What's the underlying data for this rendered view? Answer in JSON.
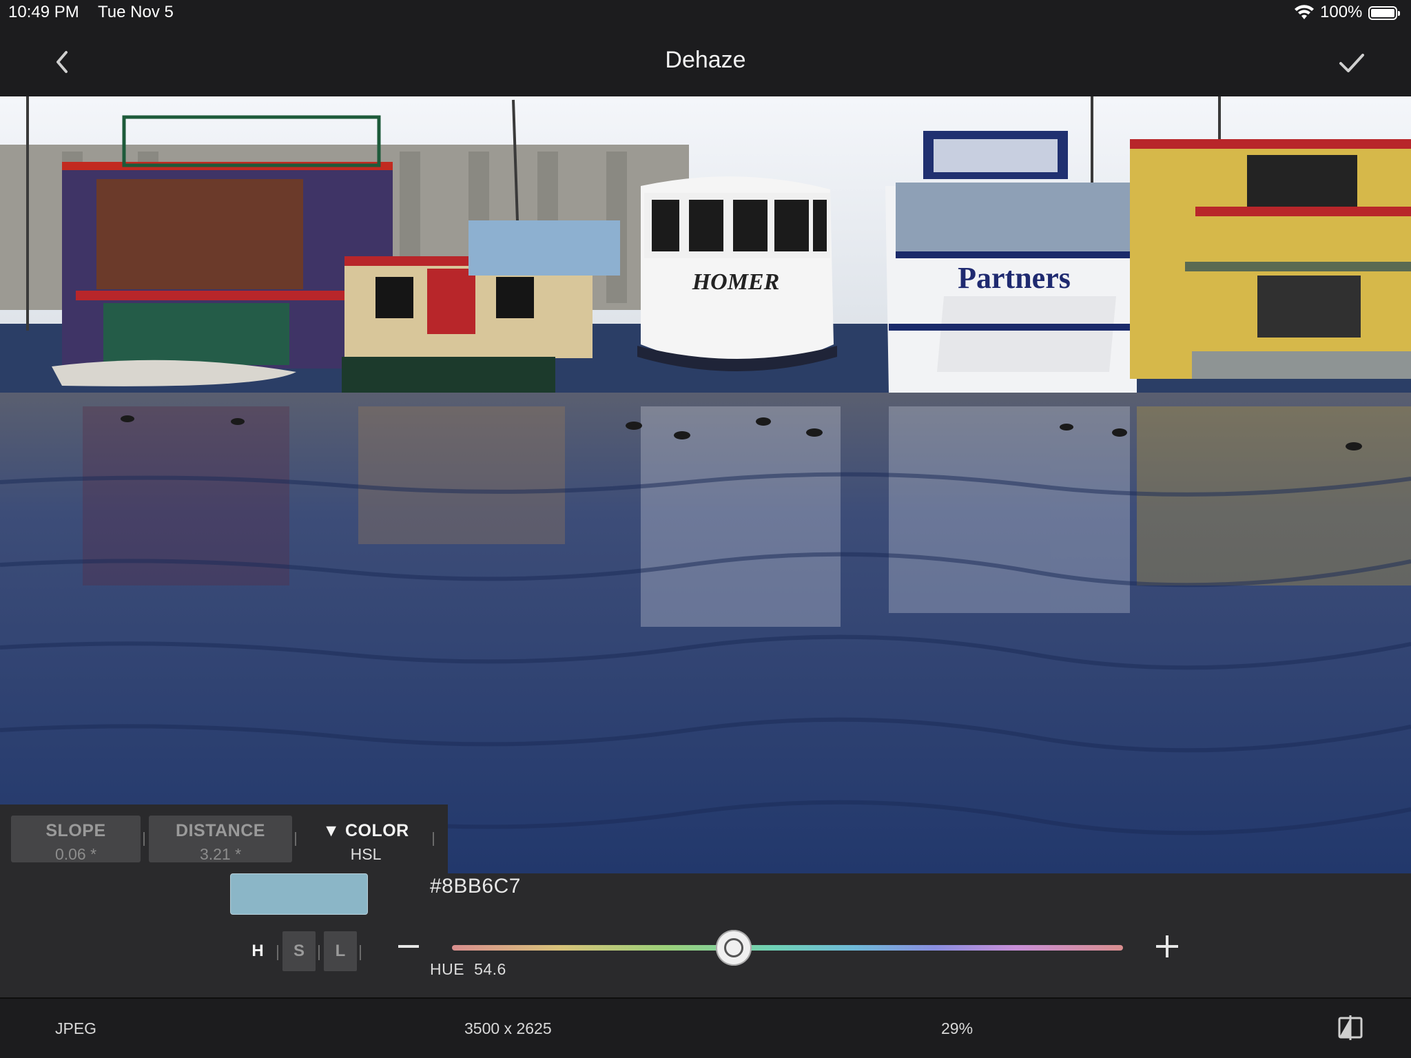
{
  "status_bar": {
    "time": "10:49 PM",
    "date": "Tue Nov 5",
    "battery": "100%"
  },
  "nav": {
    "title": "Dehaze",
    "back_icon": "chevron-left-icon",
    "done_icon": "checkmark-icon"
  },
  "photo": {
    "boat_names": [
      "HOMER",
      "Partners"
    ]
  },
  "params": {
    "slope": {
      "label": "SLOPE",
      "value": "0.06 *"
    },
    "distance": {
      "label": "DISTANCE",
      "value": "3.21 *"
    },
    "color": {
      "label": "▼ COLOR",
      "value": "HSL"
    }
  },
  "color_panel": {
    "swatch_color": "#8BB6C7",
    "hex": "#8BB6C7",
    "channels": [
      "H",
      "S",
      "L"
    ],
    "active_channel": "H",
    "slider_label": "HUE",
    "slider_value": "54.6",
    "slider_fraction": 0.42
  },
  "bottom_bar": {
    "format": "JPEG",
    "dimensions": "3500 x 2625",
    "zoom": "29%",
    "compare_icon": "compare-split-icon"
  }
}
